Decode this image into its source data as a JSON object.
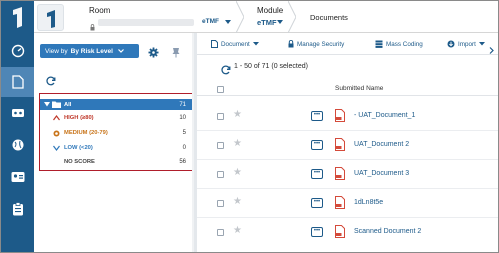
{
  "header": {
    "room_label": "Room",
    "room_tag": "eTMF",
    "module_label": "Module",
    "module_value": "eTMF",
    "page_title": "Documents"
  },
  "tree_panel": {
    "view_by_prefix": "View by",
    "view_by_value": "By Risk Level",
    "items": [
      {
        "label": "All",
        "count": "71"
      },
      {
        "label": "HIGH (≥80)",
        "count": "10"
      },
      {
        "label": "MEDIUM (20-79)",
        "count": "5"
      },
      {
        "label": "LOW (<20)",
        "count": "0"
      },
      {
        "label": "NO SCORE",
        "count": "56"
      }
    ]
  },
  "toolbar": {
    "document": "Document",
    "manage_security": "Manage Security",
    "mass_coding": "Mass Coding",
    "import": "Import"
  },
  "list": {
    "pager": "1 - 50 of 71 (0 selected)",
    "column_submitted_name": "Submitted Name",
    "rows": [
      {
        "name": "- UAT_Document_1"
      },
      {
        "name": "UAT_Document 2"
      },
      {
        "name": "UAT_Document 3"
      },
      {
        "name": "1dLn8t5e"
      },
      {
        "name": "Scanned Document 2"
      }
    ]
  },
  "colors": {
    "brand": "#1d5a89",
    "accent": "#2f78ba",
    "high": "#c0392b",
    "medium": "#c8741a",
    "highlight_box": "#b01e2b"
  }
}
